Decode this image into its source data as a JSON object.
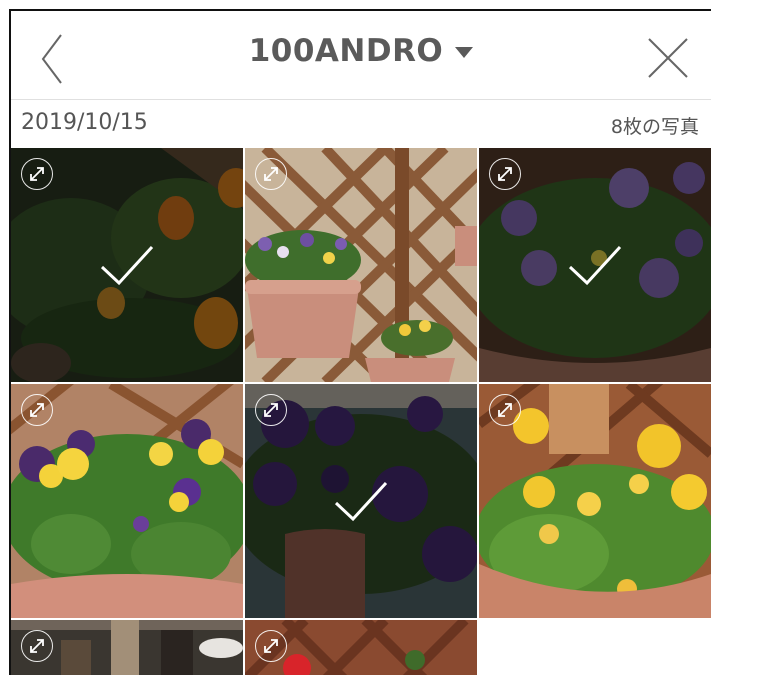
{
  "header": {
    "folder_name": "100ANDRO",
    "back_icon": "chevron-left-icon",
    "dropdown_icon": "caret-down-icon",
    "close_icon": "close-icon"
  },
  "section": {
    "date": "2019/10/15",
    "photo_count": "8枚の写真"
  },
  "photos": [
    {
      "id": 1,
      "subject": "orange pansies",
      "selected": true
    },
    {
      "id": 2,
      "subject": "planters on lattice",
      "selected": false
    },
    {
      "id": 3,
      "subject": "purple pansies",
      "selected": true
    },
    {
      "id": 4,
      "subject": "purple and yellow violas",
      "selected": false
    },
    {
      "id": 5,
      "subject": "purple petunias",
      "selected": true
    },
    {
      "id": 6,
      "subject": "yellow pansies",
      "selected": false
    },
    {
      "id": 7,
      "subject": "table items",
      "selected": false
    },
    {
      "id": 8,
      "subject": "red flowers on lattice",
      "selected": false
    }
  ],
  "colors": {
    "title": "#5a5a5a",
    "divider": "#e0e0e0",
    "selection_check": "#ffffff"
  }
}
